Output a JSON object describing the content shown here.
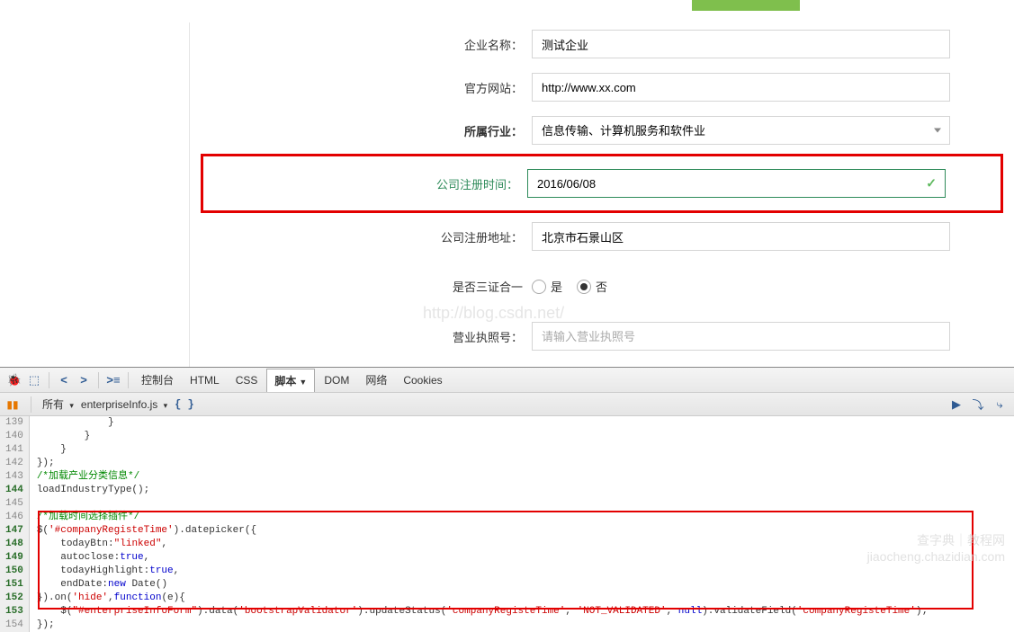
{
  "form": {
    "companyName": {
      "label": "企业名称：",
      "value": "测试企业"
    },
    "website": {
      "label": "官方网站：",
      "value": "http://www.xx.com"
    },
    "industry": {
      "label": "所属行业：",
      "value": "信息传输、计算机服务和软件业"
    },
    "registerTime": {
      "label": "公司注册时间：",
      "value": "2016/06/08"
    },
    "registerAddress": {
      "label": "公司注册地址：",
      "value": "北京市石景山区"
    },
    "threeInOne": {
      "label": "是否三证合一",
      "options": [
        "是",
        "否"
      ],
      "selected": "否"
    },
    "licenseNo": {
      "label": "营业执照号：",
      "placeholder": "请输入营业执照号"
    }
  },
  "watermark": "http://blog.csdn.net/",
  "devtools": {
    "tabs": [
      "控制台",
      "HTML",
      "CSS",
      "脚本",
      "DOM",
      "网络",
      "Cookies"
    ],
    "activeTab": "脚本",
    "filter": "所有",
    "file": "enterpriseInfo.js",
    "gutterLines": [
      "139",
      "140",
      "141",
      "142",
      "143",
      "144",
      "145",
      "146",
      "147",
      "148",
      "149",
      "150",
      "151",
      "152",
      "153",
      "154"
    ],
    "boldLines": [
      "144",
      "147",
      "148",
      "149",
      "150",
      "151",
      "152",
      "153"
    ],
    "code": {
      "l139": "            }",
      "l140": "        }",
      "l141": "    }",
      "l142": "});",
      "l143_comment": "/*加载产业分类信息*/",
      "l144": "loadIndustryType();",
      "l146_comment": "/*加载时间选择插件*/",
      "l147_a": "$(",
      "l147_b": "'#companyRegisteTime'",
      "l147_c": ").datepicker({",
      "l148_a": "    todayBtn:",
      "l148_b": "\"linked\"",
      "l148_c": ",",
      "l149_a": "    autoclose:",
      "l149_b": "true",
      "l149_c": ",",
      "l150_a": "    todayHighlight:",
      "l150_b": "true",
      "l150_c": ",",
      "l151_a": "    endDate:",
      "l151_b": "new",
      "l151_c": " Date()",
      "l152_a": "}).on(",
      "l152_b": "'hide'",
      "l152_c": ",",
      "l152_d": "function",
      "l152_e": "(e){",
      "l153_a": "    $(",
      "l153_b": "\"#enterpriseInfoForm\"",
      "l153_c": ").data(",
      "l153_d": "'bootstrapValidator'",
      "l153_e": ").updateStatus(",
      "l153_f": "'companyRegisteTime'",
      "l153_g": ", ",
      "l153_h": "'NOT_VALIDATED'",
      "l153_i": ", ",
      "l153_j": "null",
      "l153_k": ").validateField(",
      "l153_l": "'companyRegisteTime'",
      "l153_m": ");",
      "l154": "});"
    }
  },
  "bottomWatermark": {
    "line1": "查字典｜教程网",
    "line2": "jiaocheng.chazidian.com"
  }
}
